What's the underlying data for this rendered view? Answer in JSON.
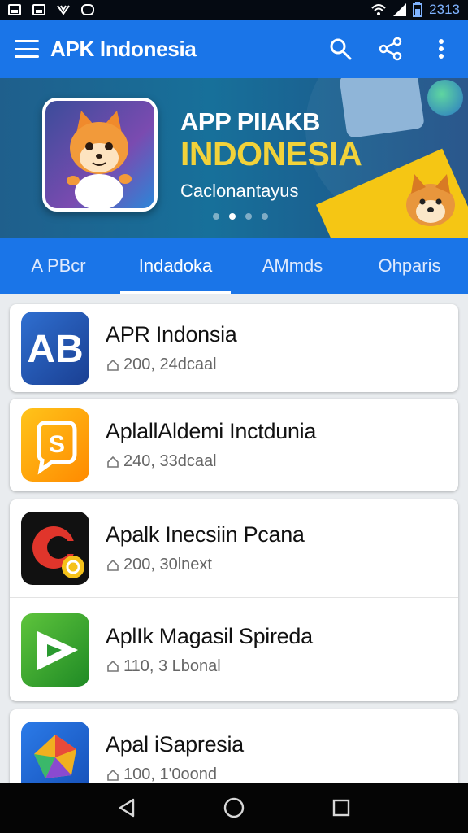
{
  "status_bar": {
    "time": "2313",
    "icons": [
      "image-icon",
      "photo-icon",
      "notification-icon",
      "message-icon",
      "wifi-icon",
      "signal-icon",
      "battery-icon"
    ]
  },
  "app_bar": {
    "title": "APK Indonesia",
    "icons": [
      "menu-icon",
      "search-icon",
      "share-icon",
      "more-icon"
    ]
  },
  "banner": {
    "headline": "APP PIIAKB",
    "highlight": "INDONESIA",
    "subtitle": "Caclonantayus",
    "slide_count": 4,
    "active_slide": 1,
    "colors": {
      "highlight": "#f2d23a",
      "background": "#17709a"
    }
  },
  "tabs": [
    {
      "label": "A PBcr",
      "active": false
    },
    {
      "label": "Indadoka",
      "active": true
    },
    {
      "label": "AMmds",
      "active": false
    },
    {
      "label": "Ohparis",
      "active": false
    }
  ],
  "apps": [
    {
      "name": "APR Indonsia",
      "meta": "200, 24dcaal",
      "icon": "ab-app-icon",
      "group": 1
    },
    {
      "name": "AplallAldemi Inctdunia",
      "meta": "240, 33dcaal",
      "icon": "dollar-app-icon",
      "group": 2
    },
    {
      "name": "Apalk Inecsiin Pcana",
      "meta": "200, 30lnext",
      "icon": "c-app-icon",
      "group": 3
    },
    {
      "name": "AplIk Magasil Spireda",
      "meta": "110, 3 Lbonal",
      "icon": "play-app-icon",
      "group": 3
    },
    {
      "name": "Apal iSapresia",
      "meta": "100, 1'0oond",
      "icon": "prism-app-icon",
      "group": 4
    }
  ],
  "nav_bar": {
    "icons": [
      "back-icon",
      "home-icon",
      "recents-icon"
    ]
  },
  "theme": {
    "primary": "#1a75e8",
    "status_bar": "#050a12",
    "list_background": "#e9ecef"
  }
}
